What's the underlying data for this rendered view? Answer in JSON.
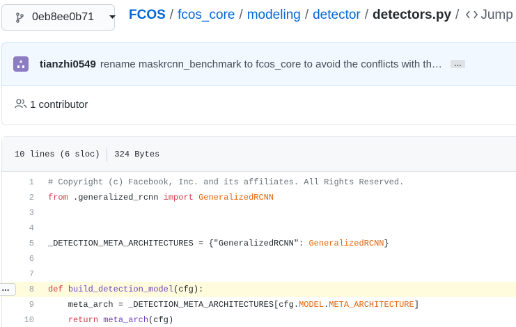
{
  "branch": {
    "name": "0eb8ee0b71",
    "icon": "git-branch-icon"
  },
  "breadcrumb": {
    "repo": "FCOS",
    "parts": [
      "fcos_core",
      "modeling",
      "detector"
    ],
    "file": "detectors.py",
    "sep": "/",
    "jump_label": "Jump to"
  },
  "commit": {
    "author": "tianzhi0549",
    "message": "rename maskrcnn_benchmark to fcos_core to avoid the conflicts with th…",
    "more_label": "…"
  },
  "contributors": {
    "label": "1 contributor"
  },
  "file_info": {
    "lines": "10 lines (6 sloc)",
    "size": "324 Bytes"
  },
  "code": {
    "line_numbers": [
      "1",
      "2",
      "3",
      "4",
      "5",
      "6",
      "7",
      "8",
      "9",
      "10"
    ],
    "line_menu_label": "…"
  },
  "colors": {
    "link": "#0366d6",
    "keyword": "#d73a49",
    "class": "#e36209",
    "highlight": "#fffbdd",
    "commit_bg": "#f1f8ff"
  }
}
